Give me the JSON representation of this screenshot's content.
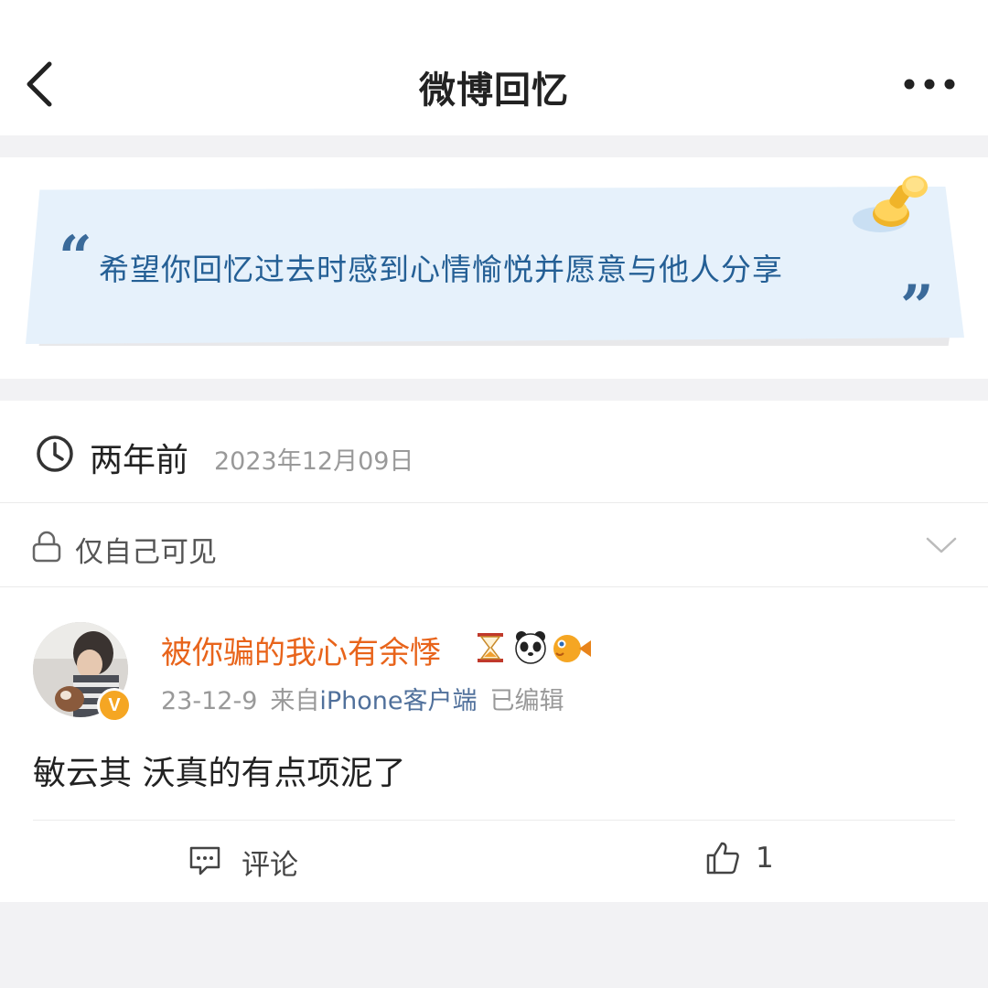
{
  "header": {
    "title": "微博回忆",
    "back_icon": "chevron-left-icon",
    "more_icon": "more-dots-icon"
  },
  "banner": {
    "quote": "希望你回忆过去时感到心情愉悦并愿意与他人分享",
    "open_quote": "“",
    "close_quote": "”",
    "pin_icon": "pushpin-icon"
  },
  "memory": {
    "relative_time": "两年前",
    "date": "2023年12月09日",
    "clock_icon": "clock-icon"
  },
  "visibility": {
    "label": "仅自己可见",
    "lock_icon": "lock-icon",
    "dropdown_icon": "chevron-down-icon"
  },
  "post": {
    "username": "被你骗的我心有余悸",
    "name_emojis": [
      "hourglass-icon",
      "panda-icon",
      "pufferfish-icon"
    ],
    "verified_badge": "V",
    "date": "23-12-9",
    "source_prefix": "来自",
    "source": "iPhone客户端",
    "edited": "已编辑",
    "text": "敏云其 沃真的有点项泥了"
  },
  "actions": {
    "comment_label": "评论",
    "like_count": "1"
  },
  "colors": {
    "username": "#e8641b",
    "quote_text": "#245f95",
    "banner_bg": "#e6f1fb",
    "source_link": "#50709b",
    "badge": "#f5a623"
  }
}
